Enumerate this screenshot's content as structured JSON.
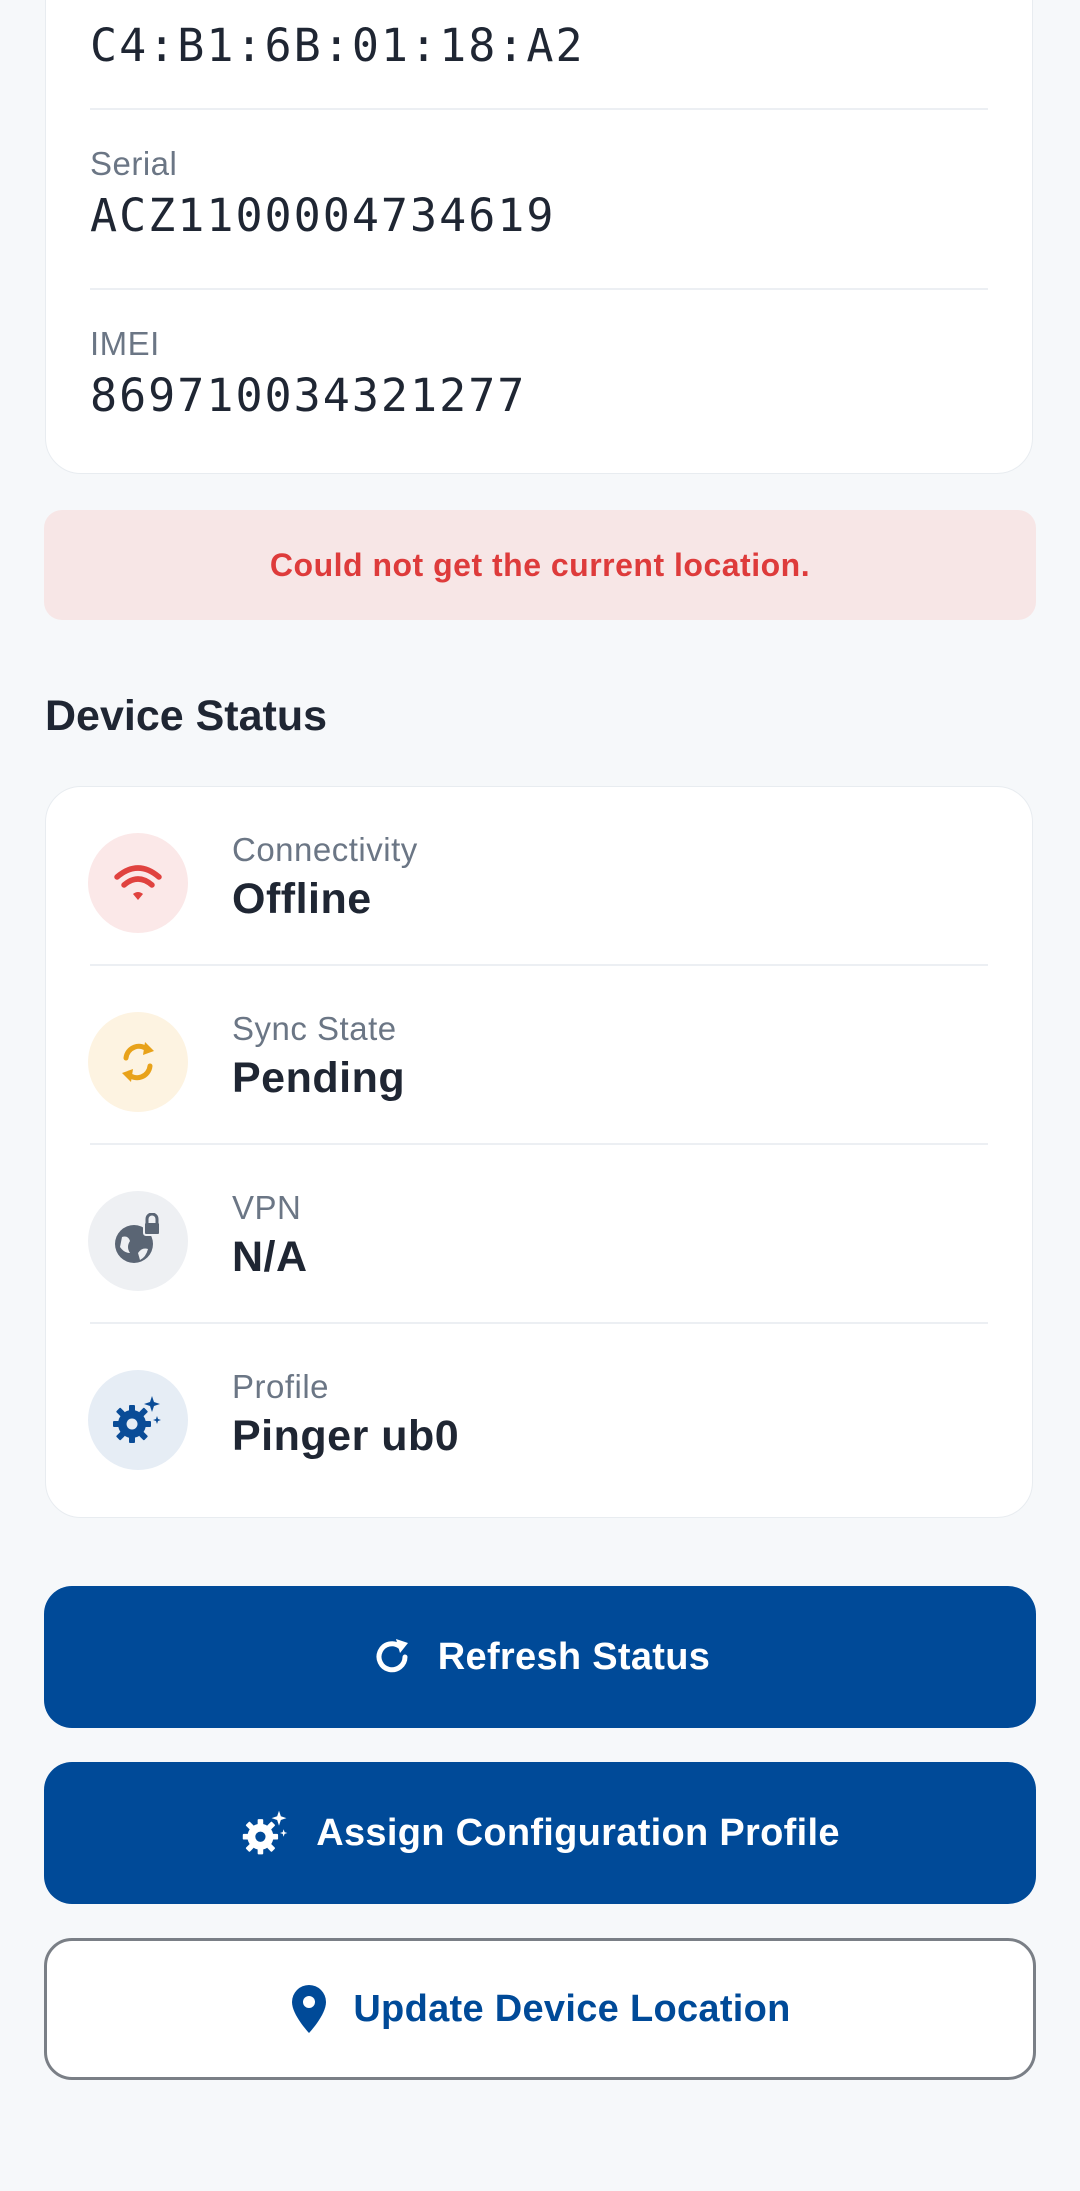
{
  "identifiers": {
    "mac_value": "C4:B1:6B:01:18:A2",
    "serial_label": "Serial",
    "serial_value": "ACZ1100004734619",
    "imei_label": "IMEI",
    "imei_value": "869710034321277"
  },
  "error_banner": {
    "text": "Could not get the current location."
  },
  "device_status": {
    "title": "Device Status",
    "items": [
      {
        "label": "Connectivity",
        "value": "Offline",
        "icon": "wifi-icon",
        "icon_color": "#e0423f",
        "icon_bg": "#fbe8e8"
      },
      {
        "label": "Sync State",
        "value": "Pending",
        "icon": "sync-icon",
        "icon_color": "#e8a21a",
        "icon_bg": "#fdf3e1"
      },
      {
        "label": "VPN",
        "value": "N/A",
        "icon": "globe-lock-icon",
        "icon_color": "#5a6574",
        "icon_bg": "#eef0f3"
      },
      {
        "label": "Profile",
        "value": "Pinger ub0",
        "icon": "gear-sparkle-icon",
        "icon_color": "#0a4c97",
        "icon_bg": "#e6edf5"
      }
    ]
  },
  "actions": {
    "refresh_label": "Refresh Status",
    "assign_label": "Assign Configuration Profile",
    "update_location_label": "Update Device Location"
  },
  "colors": {
    "primary": "#004a98",
    "error_text": "#de3b3b",
    "error_bg": "#f7e6e6"
  }
}
